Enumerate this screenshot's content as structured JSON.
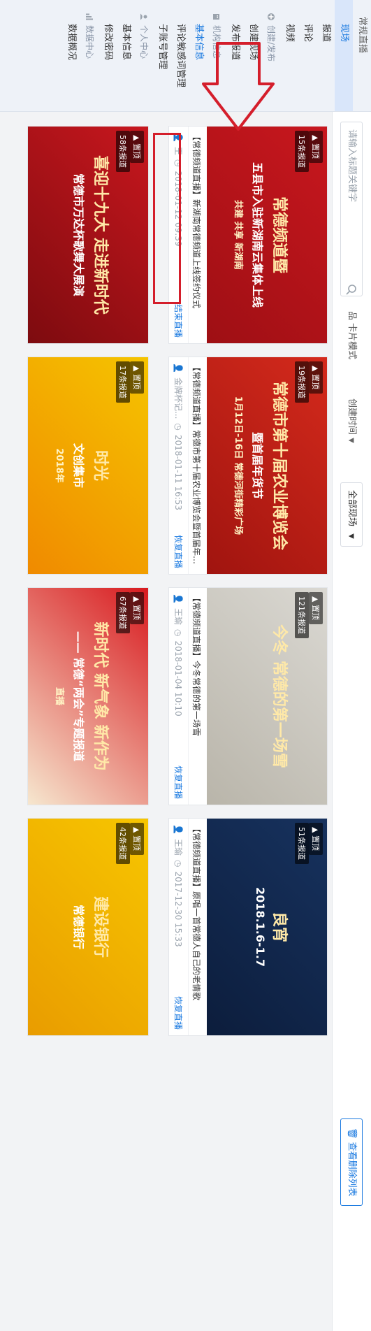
{
  "sidebar": {
    "top_item": "常规直播",
    "sections": [
      {
        "icon": "live-icon",
        "items": [
          {
            "label": "现场",
            "state": "active"
          },
          {
            "label": "报道"
          },
          {
            "label": "评论"
          },
          {
            "label": "视频"
          }
        ]
      },
      {
        "icon": "plus-circle-icon",
        "head": "创建/发布",
        "items": [
          {
            "label": "创建现场"
          },
          {
            "label": "发布报道"
          }
        ]
      },
      {
        "icon": "building-icon",
        "head": "机构信息",
        "items": [
          {
            "label": "基本信息",
            "state": "current"
          },
          {
            "label": "评论敏感词管理"
          },
          {
            "label": "子账号管理"
          }
        ]
      },
      {
        "icon": "user-icon",
        "head": "个人中心",
        "items": [
          {
            "label": "基本信息"
          },
          {
            "label": "修改密码"
          }
        ]
      },
      {
        "icon": "chart-icon",
        "head": "数据中心",
        "items": [
          {
            "label": "数据概况"
          }
        ]
      }
    ]
  },
  "toolbar": {
    "search_placeholder": "请输入标题关键字",
    "filter_label": "品 卡片模式",
    "sort_label": "创建时间",
    "select_value": "全部现场",
    "button_label": "查看删除列表"
  },
  "cards": [
    {
      "top": "置顶",
      "count": "15条报道",
      "img_line1": "常德频道暨",
      "img_line2": "五县市入驻新湖南云集体上线",
      "img_line3": "共建 共享 新湖南",
      "title": "【常德频道直播】新湖南常德频道上线签约仪式",
      "author": "王",
      "time": "2018-01-12 09:39",
      "action": "结束直播",
      "color1": "#c8171e",
      "color2": "#9e0f14"
    },
    {
      "top": "置顶",
      "count": "19条报道",
      "img_line1": "常德市第十届农业博览会",
      "img_line2": "暨首届年货节",
      "img_line3": "1月12日-16日 常德河街精彩广场",
      "title": "【常德频道直播】常德市第十届农业博览会暨首届年货节",
      "author": "金牌杯记...",
      "time": "2018-01-11 16:53",
      "action": "恢复直播",
      "color1": "#d42a1c",
      "color2": "#a0140f"
    },
    {
      "top": "置顶",
      "count": "121条报道",
      "img_line1": "今冬 常德的第一场雪",
      "img_line2": "",
      "img_line3": "",
      "title": "【常德频道直播】今冬常德的第一场雪",
      "author": "王瑜",
      "time": "2018-01-04 10:10",
      "action": "恢复直播",
      "color1": "#dad8d2",
      "color2": "#b9b5aa"
    },
    {
      "top": "置顶",
      "count": "51条报道",
      "img_line1": "良宵",
      "img_line2": "2018.1.6-1.7",
      "img_line3": "",
      "title": "【常德频道直播】原唱一首常德人自己的老情歌",
      "author": "王瑜",
      "time": "2017-12-30 15:33",
      "action": "恢复直播",
      "color1": "#17325e",
      "color2": "#0c1d3c"
    },
    {
      "top": "置顶",
      "count": "58条报道",
      "img_line1": "喜迎十九大 走进新时代",
      "img_line2": "常德市万达杯歌舞大展演",
      "img_line3": "",
      "title": "",
      "author": "",
      "time": "",
      "action": "",
      "color1": "#c8171e",
      "color2": "#7d0b0f"
    },
    {
      "top": "置顶",
      "count": "17条报道",
      "img_line1": "时光",
      "img_line2": "文创集市",
      "img_line3": "2018年",
      "title": "",
      "author": "",
      "time": "",
      "action": "",
      "color1": "#f5c400",
      "color2": "#f08a00"
    },
    {
      "top": "置顶",
      "count": "67条报道",
      "img_line1": "新时代 新气象 新作为",
      "img_line2": "—— 常德“两会”专题报道",
      "img_line3": "直播",
      "title": "",
      "author": "",
      "time": "",
      "action": "",
      "color1": "#d81a1f",
      "color2": "#f6e7cf"
    },
    {
      "top": "置顶",
      "count": "42条报道",
      "img_line1": "建设银行",
      "img_line2": "常德银行",
      "img_line3": "",
      "title": "",
      "author": "",
      "time": "",
      "action": "",
      "color1": "#f7c600",
      "color2": "#e99c00"
    }
  ]
}
